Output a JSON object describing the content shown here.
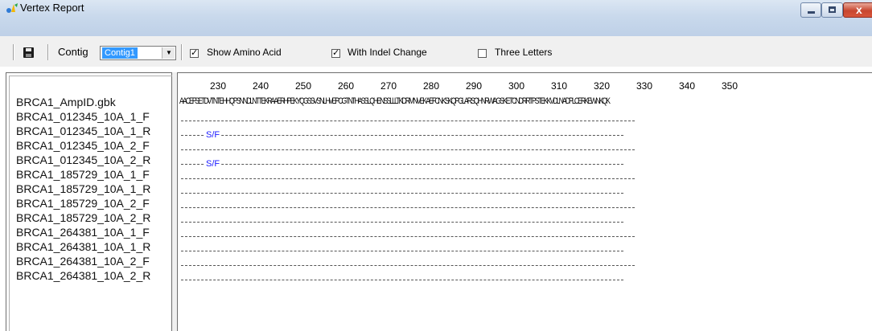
{
  "window": {
    "title": "Vertex Report",
    "minimize_label": "",
    "close_glyph": "x"
  },
  "toolbar": {
    "contig_label": "Contig",
    "contig_selected": "Contig1",
    "show_amino_acid": {
      "label": "Show Amino Acid",
      "checked": true
    },
    "with_indel_change": {
      "label": "With Indel Change",
      "checked": true
    },
    "three_letters": {
      "label": "Three Letters",
      "checked": false
    }
  },
  "sequences": {
    "reference": "BRCA1_AmpID.gbk",
    "reads": [
      "BRCA1_012345_10A_1_F",
      "BRCA1_012345_10A_1_R",
      "BRCA1_012345_10A_2_F",
      "BRCA1_012345_10A_2_R",
      "BRCA1_185729_10A_1_F",
      "BRCA1_185729_10A_1_R",
      "BRCA1_185729_10A_2_F",
      "BRCA1_185729_10A_2_R",
      "BRCA1_264381_10A_1_F",
      "BRCA1_264381_10A_1_R",
      "BRCA1_264381_10A_2_F",
      "BRCA1_264381_10A_2_R"
    ]
  },
  "ruler": [
    "230",
    "240",
    "250",
    "260",
    "270",
    "280",
    "290",
    "300",
    "310",
    "320",
    "330",
    "340",
    "350"
  ],
  "reference_sequence": "AACEFSETDVTNTEHHQPSNNDLNTTEKRAAERHPEKYQGSSVSNLHVEPCGTNTHASSLQHENSSLLLTKDRMNVEKAEFCNKSKQPGLARSQHNRWAGSKETCNDRRTPSTEKKVDLNADPLCERKEWNKQK",
  "variants": [
    {
      "row": 1,
      "label": "S/F"
    },
    {
      "row": 3,
      "label": "S/F"
    }
  ]
}
